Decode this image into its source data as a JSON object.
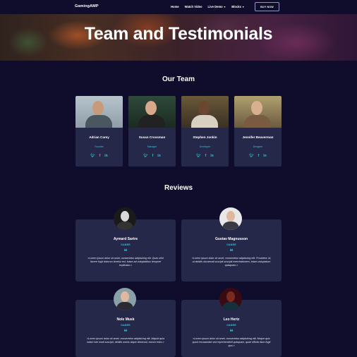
{
  "nav": {
    "brand": "GamingAMP",
    "links": [
      "Home",
      "Watch Video",
      "Live Demo",
      "Blocks"
    ],
    "buy_button": "BUY NOW"
  },
  "hero": {
    "title": "Team and Testimonials"
  },
  "team": {
    "title": "Our Team",
    "members": [
      {
        "name": "Adrian Carey",
        "role": "Founder"
      },
      {
        "name": "Susan Crossman",
        "role": "Manager"
      },
      {
        "name": "Stephen Jonkin",
        "role": "Developer"
      },
      {
        "name": "Jennifer Beaverman",
        "role": "Designer"
      }
    ],
    "social_icons": [
      "twitter-icon",
      "facebook-icon",
      "linkedin-icon"
    ]
  },
  "reviews": {
    "title": "Reviews",
    "items": [
      {
        "name": "Aymard Sartre",
        "role": "GAMER",
        "text": "«Lorem ipsum dolor sit amet, consectetur adipisicing elit. Quas nihil facere fugit dolorum tenetur est, totam ad voluptatibus tempore explicabo.»"
      },
      {
        "name": "Gustav Magnusson",
        "role": "GAMER",
        "text": "«Lorem ipsum dolor sit amet, consectetur adipisicing elit. Provident, id, ut debitis obcaecati suscipit suscipit exercitationem, totam voluptatum quisquam.»"
      },
      {
        "name": "Nole Musk",
        "role": "GAMER",
        "text": "«Lorem ipsum dolor sit amet, consectetur adipisicing elit. Aliquid quia totam iste modi suscipit, debitis omnis atque deserunt, earum enim.»"
      },
      {
        "name": "Leo Hertz",
        "role": "GAMER",
        "text": "«Lorem ipsum dolor sit amet, consectetur adipisicing elit. Neque quis quod recusandae sed reprehenderit quisquam, quae officiis illum fugit quo.»"
      }
    ]
  },
  "colors": {
    "background": "#0f0c2c",
    "card": "#252849",
    "accent": "#2ec4d6"
  }
}
